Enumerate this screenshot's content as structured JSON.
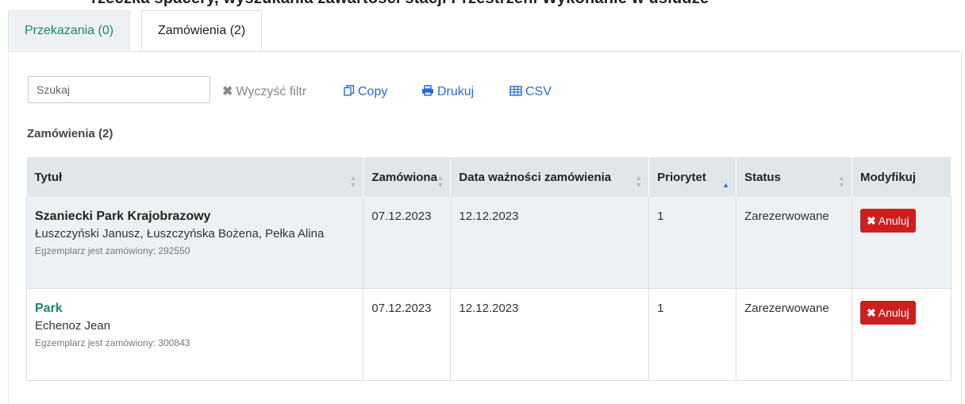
{
  "top_text": "rzeczka spacery, wyszukania zawartości stacji Przestrzeni Wykonanie w usłudze",
  "tabs": [
    {
      "label": "Przekazania (0)"
    },
    {
      "label": "Zamówienia (2)"
    }
  ],
  "toolbar": {
    "search_placeholder": "Szukaj",
    "clear_label": "Wyczyść filtr",
    "copy_label": "Copy",
    "print_label": "Drukuj",
    "csv_label": "CSV"
  },
  "section_title": "Zamówienia (2)",
  "table": {
    "headers": [
      "Tytuł",
      "Zamówiona",
      "Data ważności zamówienia",
      "Priorytet",
      "Status",
      "Modyfikuj"
    ],
    "rows": [
      {
        "title": "Szaniecki Park Krajobrazowy",
        "authors": "Łuszczyński Janusz, Łuszczyńska Bożena, Pełka Alina",
        "copy_info": "Egzemplarz jest zamówiony: 292550",
        "ordered": "07.12.2023",
        "expiry": "12.12.2023",
        "priority": "1",
        "status": "Zarezerwowane",
        "action": "Anuluj"
      },
      {
        "title": "Park",
        "authors": "Echenoz Jean",
        "copy_info": "Egzemplarz jest zamówiony: 300843",
        "ordered": "07.12.2023",
        "expiry": "12.12.2023",
        "priority": "1",
        "status": "Zarezerwowane",
        "action": "Anuluj"
      }
    ]
  },
  "colors": {
    "accent_green": "#1a8a5e",
    "link_blue": "#2a6cd6",
    "danger_red": "#cc1f1f",
    "header_bg": "#e3e6e8"
  },
  "icons": {
    "clear": "close-icon",
    "copy": "copy-icon",
    "print": "print-icon",
    "csv": "table-icon",
    "sort": "sort-icon",
    "cancel": "close-icon"
  }
}
